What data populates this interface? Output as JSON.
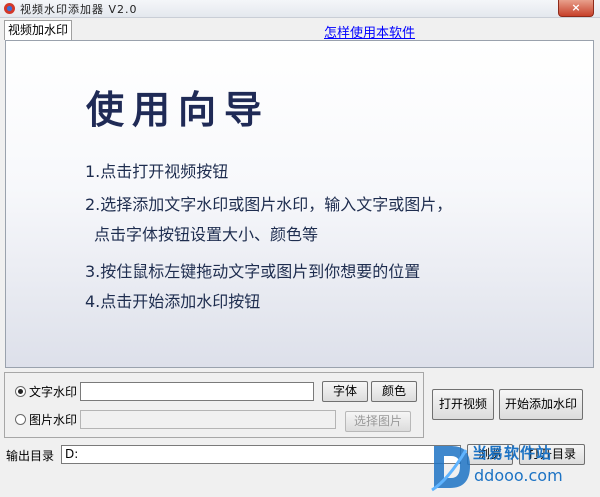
{
  "window": {
    "title": "视频水印添加器 V2.0",
    "close_label": "×"
  },
  "tabs": [
    {
      "label": "视频加水印"
    }
  ],
  "help_link": "怎样使用本软件",
  "guide": {
    "title": "使用向导",
    "steps": [
      "1.点击打开视频按钮",
      "2.选择添加文字水印或图片水印，输入文字或图片，",
      "点击字体按钮设置大小、颜色等",
      "3.按住鼠标左键拖动文字或图片到你想要的位置",
      "4.点击开始添加水印按钮"
    ]
  },
  "text_watermark": {
    "label": "文字水印",
    "selected": true,
    "value": "",
    "font_button": "字体",
    "color_button": "颜色"
  },
  "image_watermark": {
    "label": "图片水印",
    "selected": false,
    "value": "",
    "select_button": "选择图片"
  },
  "actions": {
    "open_video": "打开视频",
    "start_watermark": "开始添加水印"
  },
  "output": {
    "label": "输出目录",
    "value": "D:",
    "browse_button": "浏览",
    "open_dir_button": "打开目录"
  },
  "watermark_logo": {
    "text": "当易软件站",
    "domain": "ddooo.com"
  },
  "colors": {
    "guide_text": "#1e2d4f",
    "link": "#0000ff",
    "logo": "#1d73c4"
  }
}
